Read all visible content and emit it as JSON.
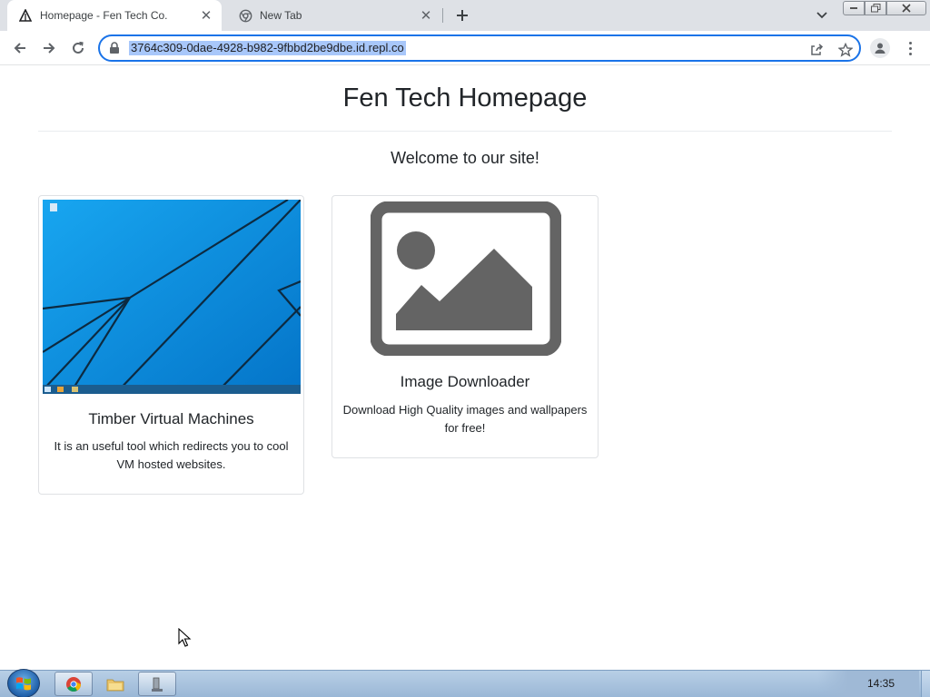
{
  "browser": {
    "tabs": [
      {
        "title": "Homepage - Fen Tech Co.",
        "active": true,
        "favicon": "triangle-logo-icon"
      },
      {
        "title": "New Tab",
        "active": false,
        "favicon": "chrome-icon"
      }
    ],
    "address_bar": {
      "url": "3764c309-0dae-4928-b982-9fbbd2be9dbe.id.repl.co",
      "selected": true
    },
    "accent_color": "#1a73e8"
  },
  "page": {
    "title": "Fen Tech Homepage",
    "welcome": "Welcome to our site!",
    "cards": [
      {
        "title": "Timber Virtual Machines",
        "text": "It is an useful tool which redirects you to cool VM hosted websites.",
        "image": "windows-desktop-screenshot"
      },
      {
        "title": "Image Downloader",
        "text": "Download High Quality images and wallpapers for free!",
        "image": "image-placeholder-icon"
      }
    ]
  },
  "taskbar": {
    "items": [
      "start-orb-icon",
      "chrome-icon",
      "file-explorer-icon",
      "app-icon"
    ],
    "clock": "14:35"
  }
}
